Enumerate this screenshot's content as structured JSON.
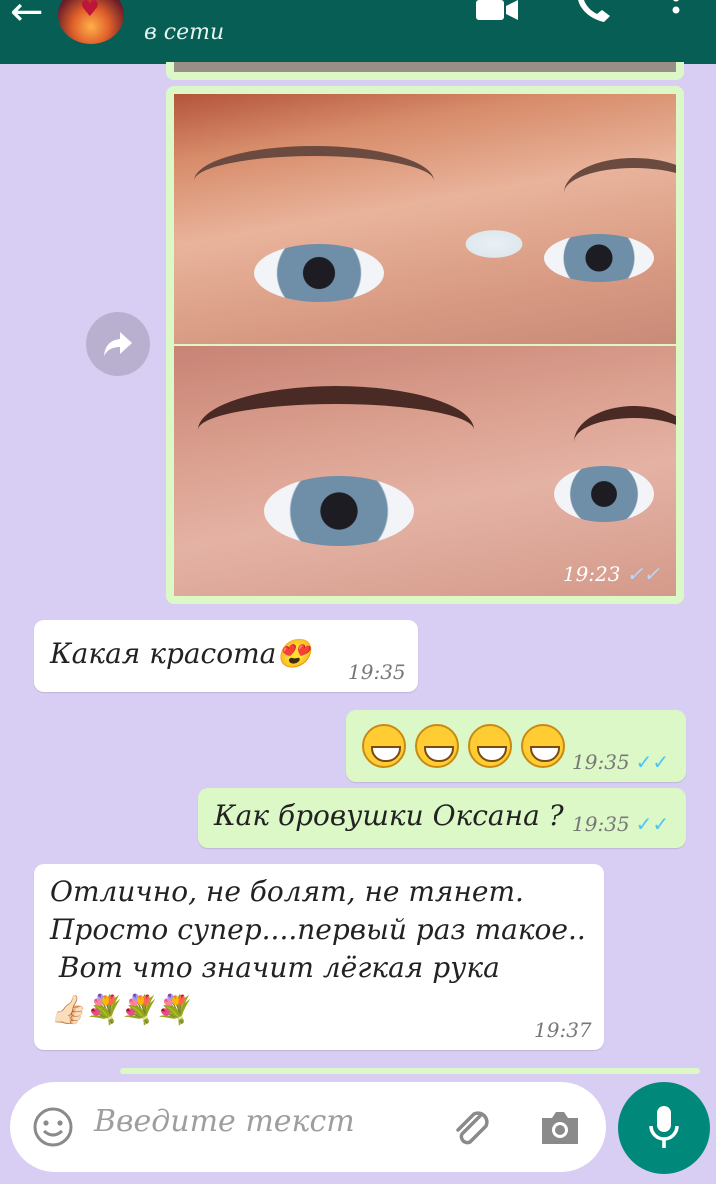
{
  "header": {
    "status": "в сети",
    "icons": [
      "back-arrow-icon",
      "avatar",
      "video-call-icon",
      "phone-icon",
      "more-vert-icon"
    ]
  },
  "messages": [
    {
      "type": "image",
      "direction": "out",
      "time": "19:23",
      "ticks": "✓✓"
    },
    {
      "type": "text",
      "direction": "in",
      "text": "Какая красота😍",
      "time": "19:35"
    },
    {
      "type": "emoji",
      "direction": "out",
      "emoji_count": 4,
      "time": "19:35",
      "ticks": "✓✓"
    },
    {
      "type": "text",
      "direction": "out",
      "text": "Как бровушки Оксана ?",
      "time": "19:35",
      "ticks": "✓✓"
    },
    {
      "type": "text",
      "direction": "in",
      "lines": [
        "Отлично, не болят, не тянет.",
        "Просто супер....первый раз такое..",
        " Вот что значит лёгкая рука",
        "👍🏻💐💐💐"
      ],
      "time": "19:37"
    }
  ],
  "input": {
    "placeholder": "Введите текст"
  },
  "colors": {
    "header": "#075e54",
    "background": "#d8cdf2",
    "outgoing": "#dcf8c6",
    "incoming": "#ffffff",
    "accent": "#00897b",
    "tick": "#4fc3f7"
  }
}
